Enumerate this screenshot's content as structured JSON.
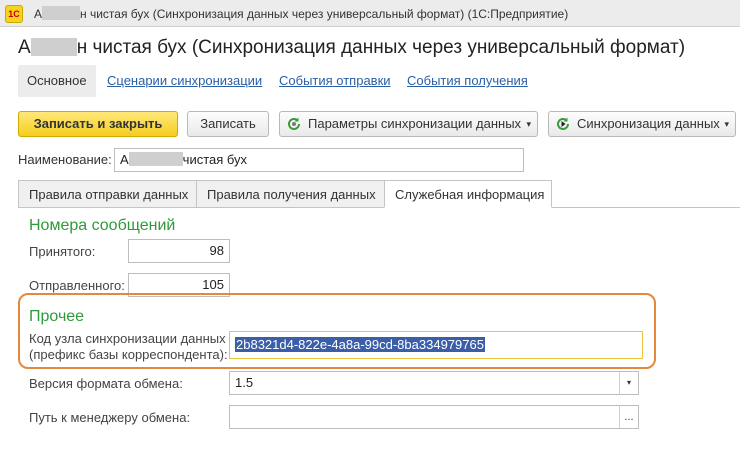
{
  "window": {
    "title_start": "А",
    "title_end": "н чистая бух (Синхронизация данных через универсальный формат)  (1С:Предприятие)",
    "logo_text": "1С"
  },
  "form": {
    "title_start": "А",
    "title_end": "н чистая бух (Синхронизация данных через универсальный формат)"
  },
  "nav": [
    {
      "label": "Основное",
      "active": true
    },
    {
      "label": "Сценарии синхронизации",
      "active": false
    },
    {
      "label": "События отправки",
      "active": false
    },
    {
      "label": "События получения",
      "active": false
    }
  ],
  "toolbar": {
    "save_close": "Записать и закрыть",
    "save": "Записать",
    "params": "Параметры синхронизации данных",
    "sync": "Синхронизация данных",
    "dropdown_arrow": "▾"
  },
  "name": {
    "label": "Наименование:",
    "value_start": "А",
    "value_end": "чистая бух"
  },
  "tabs": [
    {
      "label": "Правила отправки данных",
      "active": false
    },
    {
      "label": "Правила получения данных",
      "active": false
    },
    {
      "label": "Служебная информация",
      "active": true
    }
  ],
  "messages": {
    "group": "Номера сообщений",
    "received_label": "Принятого:",
    "received_value": "98",
    "sent_label": "Отправленного:",
    "sent_value": "105"
  },
  "other": {
    "group": "Прочее",
    "code_label_1": "Код узла синхронизации данных",
    "code_label_2": "(префикс базы корреспондента):",
    "code_value": "2b8321d4-822e-4a8a-99cd-8ba334979765",
    "format_label": "Версия формата обмена:",
    "format_value": "1.5",
    "manager_label": "Путь к менеджеру обмена:",
    "manager_value": "",
    "manager_button": "..."
  },
  "colors": {
    "accent_green": "#2e9a3a",
    "link_blue": "#2a5fa8",
    "primary_yellow": "#f5cd1f",
    "highlight_orange": "#e5883b",
    "selection_blue": "#3b5ea8"
  },
  "icons": {
    "params": "refresh-settings-icon",
    "sync": "sync-play-icon"
  }
}
